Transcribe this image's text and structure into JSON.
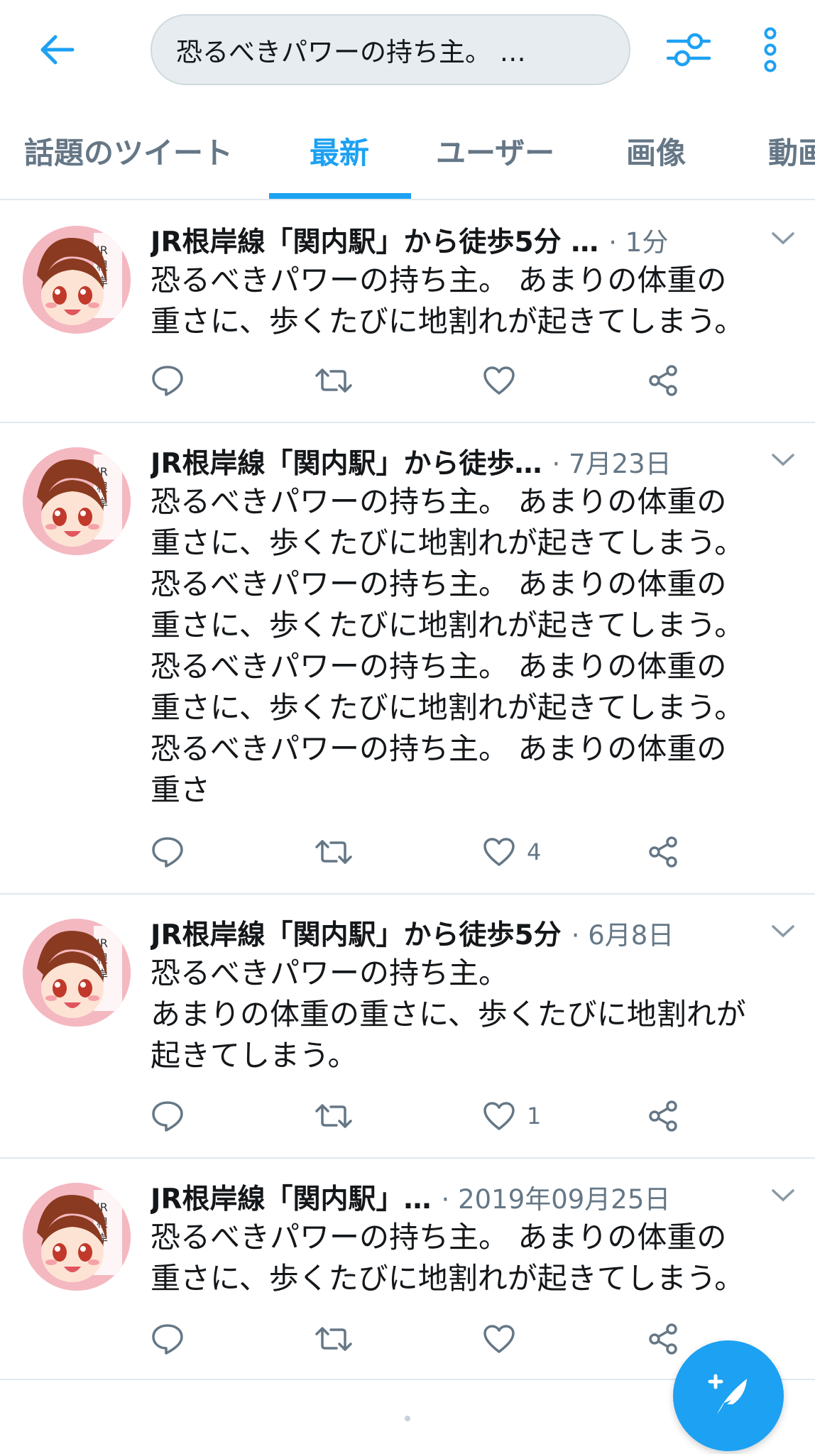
{
  "header": {
    "search_query": "恐るべきパワーの持ち主。 …",
    "colors": {
      "accent": "#1da1f2",
      "secondary_text": "#657786",
      "search_bg": "#e6ecf0"
    }
  },
  "tabs": [
    {
      "label": "話題のツイート",
      "active": false
    },
    {
      "label": "最新",
      "active": true
    },
    {
      "label": "ユーザー",
      "active": false
    },
    {
      "label": "画像",
      "active": false
    },
    {
      "label": "動画",
      "active": false
    }
  ],
  "tweets": [
    {
      "name": "JR根岸線「関内駅」から徒歩5分 …",
      "time": "· 1分",
      "text": "恐るべきパワーの持ち主。 あまりの体重の\n重さに、歩くたびに地割れが起きてしまう。",
      "like_count": ""
    },
    {
      "name": "JR根岸線「関内駅」から徒歩…",
      "time": "· 7月23日",
      "text": "恐るべきパワーの持ち主。 あまりの体重の\n重さに、歩くたびに地割れが起きてしまう。\n恐るべきパワーの持ち主。 あまりの体重の\n重さに、歩くたびに地割れが起きてしまう。\n恐るべきパワーの持ち主。 あまりの体重の\n重さに、歩くたびに地割れが起きてしまう。\n恐るべきパワーの持ち主。 あまりの体重の\n重さ",
      "like_count": "4"
    },
    {
      "name": "JR根岸線「関内駅」から徒歩5分",
      "time": "· 6月8日",
      "text": "恐るべきパワーの持ち主。\nあまりの体重の重さに、歩くたびに地割れが\n起きてしまう。",
      "like_count": "1"
    },
    {
      "name": "JR根岸線「関内駅」…",
      "time": "· 2019年09月25日",
      "text": "恐るべきパワーの持ち主。 あまりの体重の\n重さに、歩くたびに地割れが起きてしまう。",
      "like_count": ""
    }
  ],
  "icons": {
    "back": "arrow-left-icon",
    "filter": "sliders-icon",
    "more": "vertical-dots-icon",
    "reply": "comment-icon",
    "retweet": "retweet-icon",
    "like": "heart-icon",
    "share": "share-icon",
    "compose": "compose-feather-icon"
  }
}
